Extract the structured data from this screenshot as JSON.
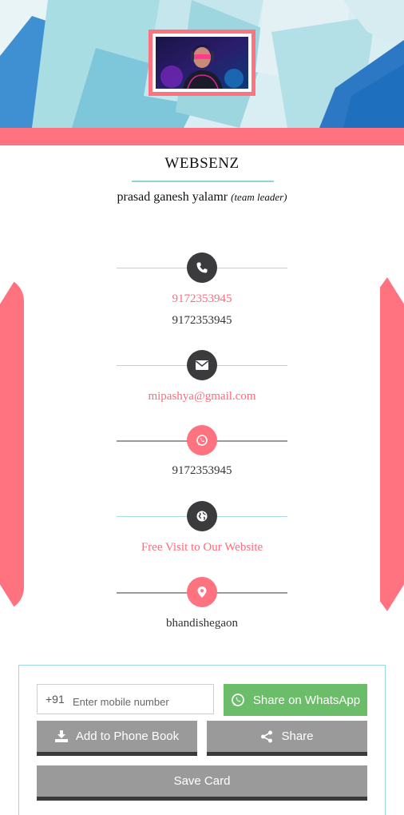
{
  "header": {
    "company_name": "WEBSENZ",
    "person_name": "prasad ganesh yalamr",
    "person_role": "(team leader)"
  },
  "contacts": [
    {
      "icon": "phone-icon",
      "primary": "9172353945",
      "secondary": "9172353945"
    },
    {
      "icon": "envelope-icon",
      "primary": "mipashya@gmail.com"
    },
    {
      "icon": "whatsapp-icon",
      "secondary": "9172353945"
    },
    {
      "icon": "globe-icon",
      "primary": "Free Visit to Our Website"
    },
    {
      "icon": "location-pin-icon",
      "secondary": "bhandishegaon"
    }
  ],
  "share_panel": {
    "country_code": "+91",
    "phone_placeholder": "Enter mobile number",
    "whatsapp_label": "Share on WhatsApp",
    "add_phonebook_label": "Add to Phone Book",
    "share_label": "Share",
    "save_card_label": "Save Card"
  },
  "colors": {
    "accent_pink": "#ff7280",
    "dark_circle": "#3b3b3d",
    "whatsapp_green": "#6cbd6a",
    "button_grey": "#9a9a9a",
    "teal_line": "#a6dce0"
  }
}
